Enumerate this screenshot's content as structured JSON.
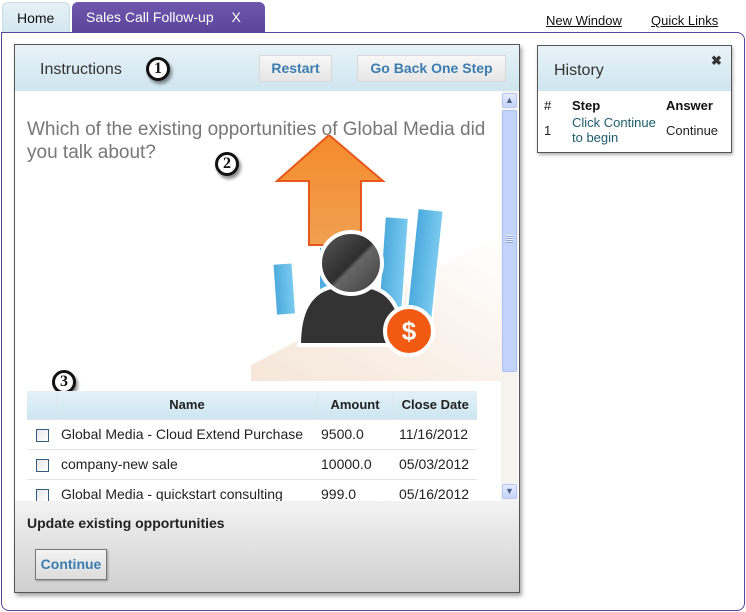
{
  "tabs": [
    {
      "label": "Home",
      "active": false
    },
    {
      "label": "Sales Call Follow-up",
      "active": true,
      "close_glyph": "X"
    }
  ],
  "top_links": {
    "new_window": "New Window",
    "quick_links": "Quick Links"
  },
  "instructions": {
    "title": "Instructions",
    "badges": [
      "1",
      "2",
      "3"
    ],
    "buttons": {
      "restart": "Restart",
      "go_back": "Go Back One Step"
    },
    "question": "Which of the existing opportunities of  Global Media did you talk about?",
    "illustration": "sales-growth-person-icon",
    "table": {
      "columns": [
        "",
        "Name",
        "Amount",
        "Close Date"
      ],
      "rows": [
        {
          "checked": false,
          "name": "Global Media - Cloud Extend Purchase",
          "amount": "9500.0",
          "close_date": "11/16/2012"
        },
        {
          "checked": false,
          "name": "company-new sale",
          "amount": "10000.0",
          "close_date": "05/03/2012"
        },
        {
          "checked": false,
          "name": "Global Media - quickstart consulting",
          "amount": "999.0",
          "close_date": "05/16/2012"
        }
      ]
    },
    "footer_label": "Update existing opportunities",
    "continue_label": "Continue"
  },
  "history": {
    "title": "History",
    "close_glyph": "✖",
    "columns": [
      "#",
      "Step",
      "Answer"
    ],
    "rows": [
      {
        "num": "1",
        "step": "Click Continue to begin",
        "answer": "Continue"
      }
    ]
  },
  "colors": {
    "accent_purple": "#5b449a",
    "header_blue": "#cfe5ef",
    "button_text_blue": "#3b7db0",
    "link_teal": "#1d5c6d",
    "arrow_orange": "#f07a1d",
    "bar_blue": "#5ab4e0"
  }
}
